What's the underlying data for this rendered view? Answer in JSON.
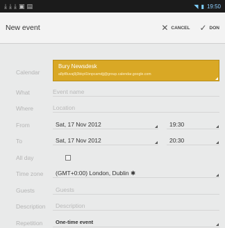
{
  "status_bar": {
    "left_icons": [
      "download-icon",
      "download-icon",
      "download-icon",
      "gallery-icon",
      "photo-icon"
    ],
    "time": "19:50"
  },
  "action_bar": {
    "title": "New event",
    "cancel_label": "CANCEL",
    "done_label": "DON"
  },
  "form": {
    "calendar": {
      "label": "Calendar",
      "name": "Bury Newsdesk",
      "email": "a8pf8uvaj9j3bkpt1bnpcamdjj@group.calendar.google.com",
      "color": "#d9a825"
    },
    "what": {
      "label": "What",
      "placeholder": "Event name"
    },
    "where": {
      "label": "Where",
      "placeholder": "Location"
    },
    "from": {
      "label": "From",
      "date": "Sat, 17 Nov 2012",
      "time": "19:30"
    },
    "to": {
      "label": "To",
      "date": "Sat, 17 Nov 2012",
      "time": "20:30"
    },
    "all_day": {
      "label": "All day",
      "checked": false
    },
    "time_zone": {
      "label": "Time zone",
      "value": "(GMT+0:00) London, Dublin ✱"
    },
    "guests": {
      "label": "Guests",
      "placeholder": "Guests"
    },
    "description": {
      "label": "Description",
      "placeholder": "Description"
    },
    "repetition": {
      "label": "Repetition",
      "value": "One-time event"
    }
  }
}
